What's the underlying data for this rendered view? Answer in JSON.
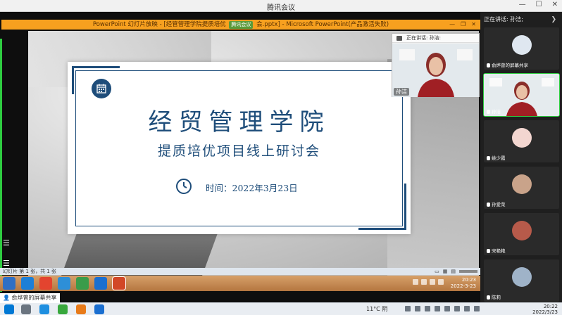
{
  "meeting_window": {
    "title": "腾讯会议",
    "controls": [
      "—",
      "☐",
      "✕"
    ]
  },
  "ppt_window": {
    "title_prefix": "PowerPoint 幻灯片放映 - [经管管理学院提质培优",
    "share_chip": "腾讯会议",
    "title_suffix": "会.pptx] - Microsoft PowerPoint(产品激活失败)",
    "controls": [
      "—",
      "❐",
      "✕"
    ]
  },
  "slide": {
    "title": "经贸管理学院",
    "subtitle": "提质培优项目线上研讨会",
    "date": "时间：2022年3月23日"
  },
  "speaker_float": {
    "label": "正在讲话: 孙洁:",
    "name": "孙洁"
  },
  "ppt_status": {
    "slide_info": "幻灯片 第 1 张，共 1 张"
  },
  "remote_taskbar": {
    "time": "20:23",
    "date": "2022-3-23"
  },
  "participants": {
    "header": "正在讲话: 孙洁;",
    "tiles": [
      {
        "name": "俞烨曾的屏幕共享"
      },
      {
        "name": "孙洁"
      },
      {
        "name": "姚少霞"
      },
      {
        "name": "孙爱荣"
      },
      {
        "name": "宋艳艳"
      },
      {
        "name": "陈莉"
      }
    ]
  },
  "local_taskbar": {
    "share_note": "俞烨曾的屏幕共享",
    "weather": "11°C 阴",
    "time": "20:22",
    "date": "2022/3/23"
  },
  "colors": {
    "slide_blue": "#1e4d7a",
    "ppt_titlebar": "#f7a01f",
    "sharing_green": "#2ecc40"
  }
}
